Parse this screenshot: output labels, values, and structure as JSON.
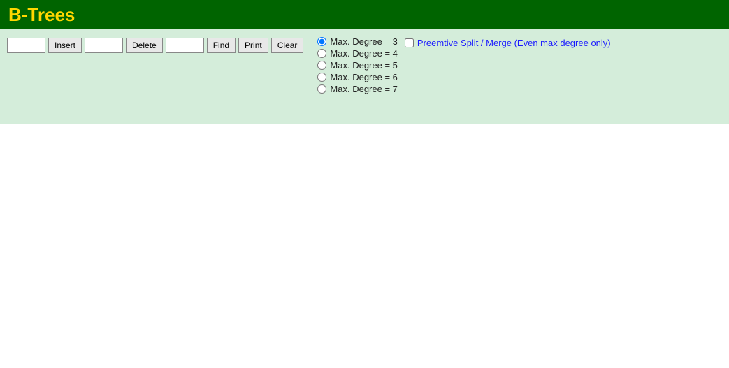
{
  "header": {
    "title": "B-Trees"
  },
  "toolbar": {
    "insert_button": "Insert",
    "delete_button": "Delete",
    "find_button": "Find",
    "print_button": "Print",
    "clear_button": "Clear",
    "insert_placeholder": "",
    "delete_placeholder": "",
    "find_placeholder": ""
  },
  "radio_options": [
    {
      "label": "Max. Degree = 3",
      "value": "3",
      "checked": true
    },
    {
      "label": "Max. Degree = 4",
      "value": "4",
      "checked": false
    },
    {
      "label": "Max. Degree = 5",
      "value": "5",
      "checked": false
    },
    {
      "label": "Max. Degree = 6",
      "value": "6",
      "checked": false
    },
    {
      "label": "Max. Degree = 7",
      "value": "7",
      "checked": false
    }
  ],
  "preemtive": {
    "label": "Preemtive Split / Merge (Even max degree only)"
  }
}
